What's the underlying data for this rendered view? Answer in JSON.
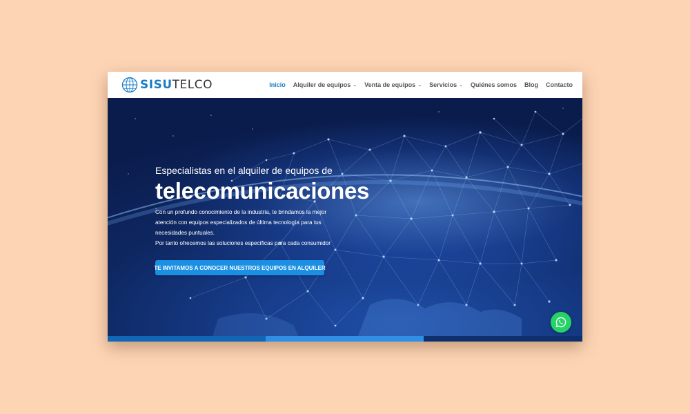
{
  "logo": {
    "part1": "SISU",
    "part2": "TELCO",
    "icon": "globe-icon"
  },
  "nav": {
    "items": [
      {
        "label": "Inicio",
        "active": true,
        "dropdown": false
      },
      {
        "label": "Alquiler de equipos",
        "active": false,
        "dropdown": true
      },
      {
        "label": "Venta de equipos",
        "active": false,
        "dropdown": true
      },
      {
        "label": "Servicios",
        "active": false,
        "dropdown": true
      },
      {
        "label": "Quiénes somos",
        "active": false,
        "dropdown": false
      },
      {
        "label": "Blog",
        "active": false,
        "dropdown": false
      },
      {
        "label": "Contacto",
        "active": false,
        "dropdown": false
      }
    ],
    "chevron_icon": "chevron-down-icon"
  },
  "hero": {
    "subtitle": "Especialistas en el alquiler de equipos de",
    "title": "telecomunicaciones",
    "description_lines": [
      "Con un profundo conocimiento de la industria, te brindamos la mejor",
      "atención con equipos especializados de última tecnología para tus",
      "necesidades puntuales.",
      "Por tanto ofrecemos las soluciones específicas para cada consumidor"
    ],
    "cta_label": "TE INVITAMOS A CONOCER NUESTROS EQUIPOS EN ALQUILER"
  },
  "whatsapp": {
    "icon": "whatsapp-icon"
  },
  "colors": {
    "page_background": "#fdd5b5",
    "brand_blue": "#1a7cc7",
    "cta_blue": "#1b8fe4",
    "whatsapp_green": "#25d366",
    "hero_dark": "#0a1c4c"
  }
}
